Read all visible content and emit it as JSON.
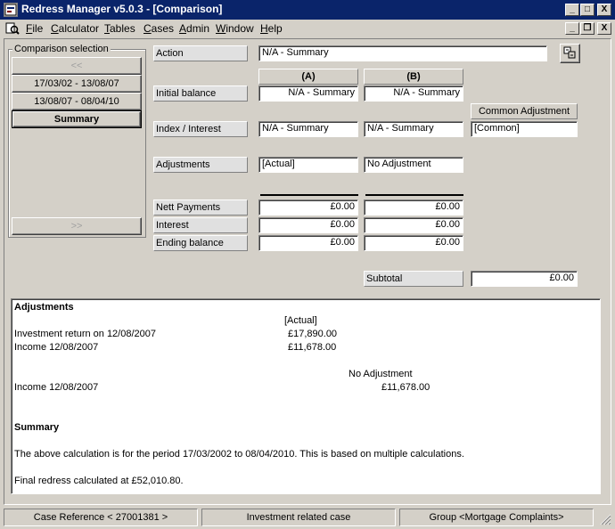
{
  "window": {
    "title": "Redress Manager v5.0.3 - [Comparison]",
    "controls": {
      "minimize": "_",
      "maximize": "□",
      "close": "X"
    },
    "mdi_controls": {
      "minimize": "_",
      "restore": "❐",
      "close": "X"
    }
  },
  "menu": {
    "items": [
      {
        "key": "F",
        "rest": "ile"
      },
      {
        "key": "C",
        "rest": "alculator"
      },
      {
        "key": "T",
        "rest": "ables"
      },
      {
        "key": "C",
        "rest": "ases"
      },
      {
        "key": "A",
        "rest": "dmin"
      },
      {
        "key": "W",
        "rest": "indow"
      },
      {
        "key": "H",
        "rest": "elp"
      }
    ]
  },
  "comparison_selection": {
    "title": "Comparison selection",
    "prev_label": "<<",
    "next_label": ">>",
    "items": [
      {
        "label": "17/03/02 - 13/08/07"
      },
      {
        "label": "13/08/07 - 08/04/10"
      },
      {
        "label": "Summary"
      }
    ]
  },
  "form": {
    "action_label": "Action",
    "action_value": "N/A - Summary",
    "col_a": "(A)",
    "col_b": "(B)",
    "common_adjustment": "Common Adjustment",
    "rows": {
      "initial_balance": {
        "label": "Initial balance",
        "a": "N/A - Summary",
        "b": "N/A - Summary"
      },
      "index_interest": {
        "label": "Index / Interest",
        "a": "N/A - Summary",
        "b": "N/A - Summary",
        "common": "[Common]"
      },
      "adjustments": {
        "label": "Adjustments",
        "a": "[Actual]",
        "b": "No Adjustment"
      },
      "nett_payments": {
        "label": "Nett Payments",
        "a": "£0.00",
        "b": "£0.00"
      },
      "interest": {
        "label": "Interest",
        "a": "£0.00",
        "b": "£0.00"
      },
      "ending_balance": {
        "label": "Ending balance",
        "a": "£0.00",
        "b": "£0.00"
      }
    },
    "subtotal_label": "Subtotal",
    "subtotal_value": "£0.00"
  },
  "report": {
    "adjustments_heading": "Adjustments",
    "actual_header": "[Actual]",
    "actual_lines": [
      {
        "label": "Investment return on 12/08/2007",
        "value": "£17,890.00"
      },
      {
        "label": "Income 12/08/2007",
        "value": "£11,678.00"
      }
    ],
    "no_adjustment_header": "No Adjustment",
    "no_adjustment_lines": [
      {
        "label": "Income 12/08/2007",
        "value": "£11,678.00"
      }
    ],
    "summary_heading": "Summary",
    "summary_text": "The above calculation is for the period 17/03/2002 to 08/04/2010. This is based on multiple calculations.",
    "final_text": "Final redress calculated at £52,010.80."
  },
  "status": {
    "case_reference": "Case Reference < 27001381 >",
    "case_type": "Investment related case",
    "group": "Group <Mortgage Complaints>"
  }
}
